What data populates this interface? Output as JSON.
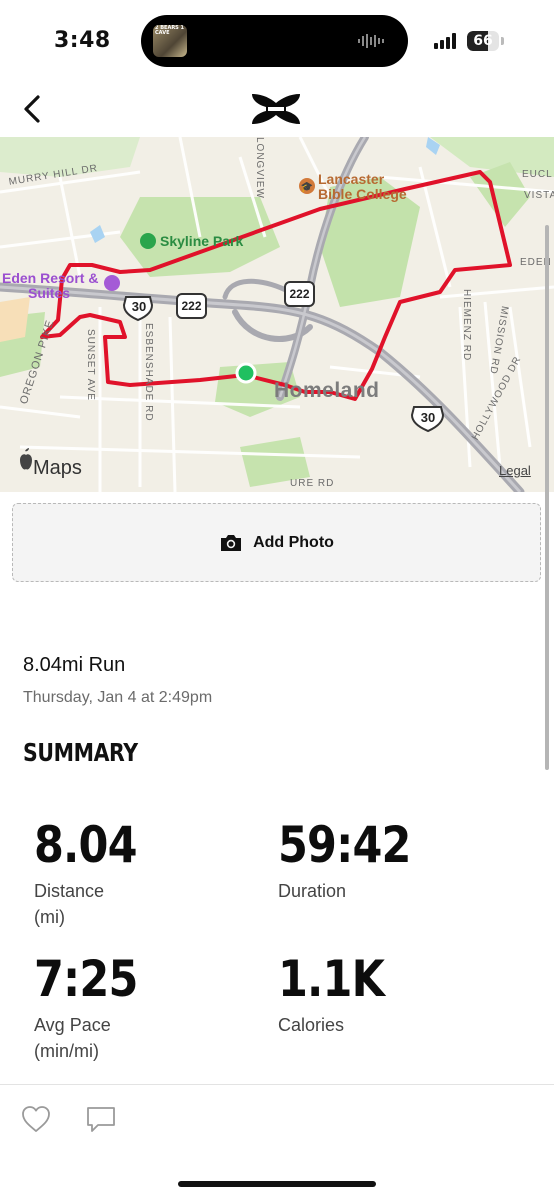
{
  "status_bar": {
    "time": "3:48",
    "now_playing_art_text": "2 BEARS 1 CAVE",
    "battery_level": "66",
    "icons": [
      "audio-waveform-icon",
      "cellular-signal-icon",
      "battery-icon"
    ]
  },
  "nav": {
    "back_icon": "chevron-left-icon",
    "logo": "under-armour-logo"
  },
  "map": {
    "labels": {
      "murry_hill": "MURRY HILL DR",
      "lancaster_bible_1": "Lancaster",
      "lancaster_bible_2": "Bible College",
      "skyline_park": "Skyline Park",
      "eden_resort_1": "Eden Resort &",
      "eden_resort_2": "Suites",
      "oregon_pike": "OREGON PIKE",
      "sunset_ave": "SUNSET AVE",
      "esbenshade_rd": "ESBENSHADE RD",
      "homeland": "Homeland",
      "hiemenz_rd": "HIEMENZ RD",
      "mission_rd": "MISSION RD",
      "hollywood_dr": "HOLLYWOOD DR",
      "longview": "LONGVIEW",
      "eucl": "EUCL",
      "vista": "VISTA",
      "eden": "EDEN",
      "ure_rd": "URE RD",
      "maps_attribution": "Maps",
      "legal": "Legal"
    },
    "shields": {
      "us30_a": "30",
      "us222_a": "222",
      "us222_b": "222",
      "us30_b": "30"
    },
    "colors": {
      "route": "#e0122a",
      "start_marker": "#20c060",
      "park": "#bfe1a6",
      "highway": "#a9a9b0"
    }
  },
  "add_photo": {
    "label": "Add Photo",
    "icon": "camera-icon"
  },
  "workout": {
    "title": "8.04mi Run",
    "date": "Thursday, Jan 4 at 2:49pm"
  },
  "summary": {
    "heading": "SUMMARY",
    "distance": {
      "value": "8.04",
      "label": "Distance",
      "unit": "(mi)"
    },
    "duration": {
      "value": "59:42",
      "label": "Duration"
    },
    "avg_pace": {
      "value": "7:25",
      "label": "Avg Pace",
      "unit": "(min/mi)"
    },
    "calories": {
      "value": "1.1K",
      "label": "Calories"
    }
  },
  "social": {
    "like_icon": "heart-icon",
    "comment_icon": "comment-icon"
  }
}
